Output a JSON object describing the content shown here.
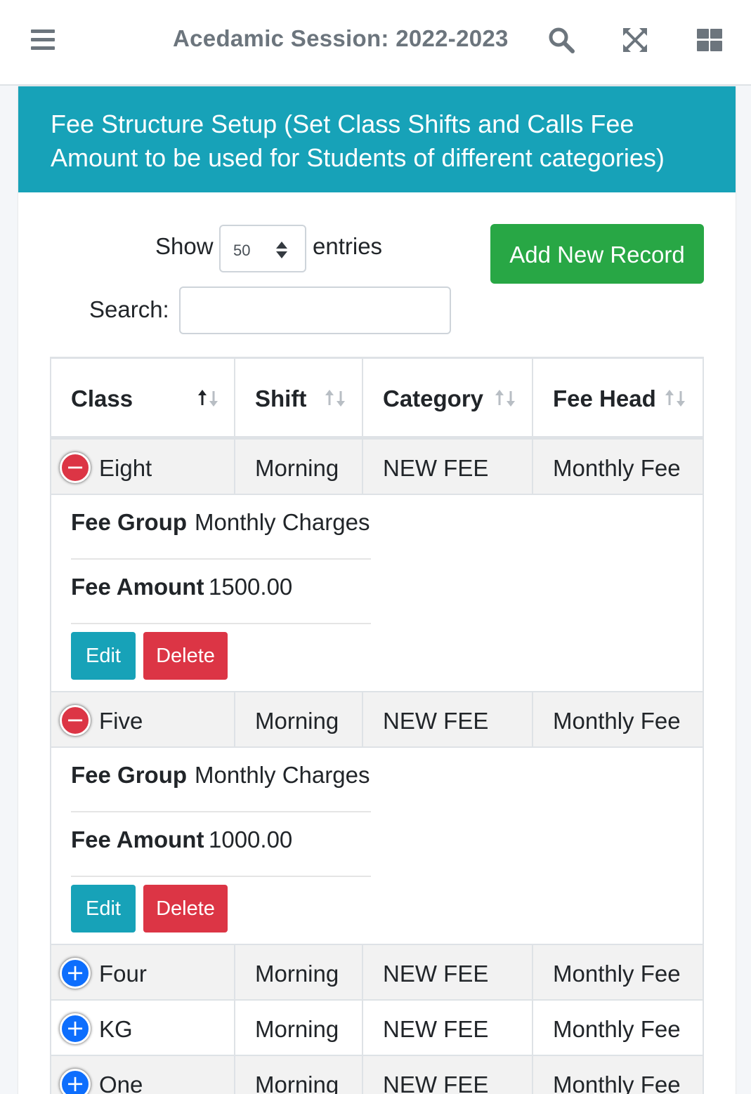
{
  "topbar": {
    "title": "Acedamic Session: 2022-2023",
    "icons": [
      "menu-icon",
      "search-icon",
      "fullscreen-icon",
      "apps-grid-icon"
    ]
  },
  "card": {
    "title": "Fee Structure Setup (Set Class Shifts and Calls Fee Amount to be used for Students of different categories)",
    "header_color": "#17a2b8"
  },
  "controls": {
    "show_label": "Show",
    "page_size": "50",
    "entries_label": "entries",
    "search_label": "Search:",
    "search_value": "",
    "add_button": "Add New Record",
    "add_button_color": "#28a745"
  },
  "table": {
    "columns": [
      "Class",
      "Shift",
      "Category",
      "Fee Head"
    ],
    "rows": [
      {
        "class": "Eight",
        "shift": "Morning",
        "category": "NEW FEE",
        "fee_head": "Monthly Fee",
        "expanded": true
      },
      {
        "class": "Five",
        "shift": "Morning",
        "category": "NEW FEE",
        "fee_head": "Monthly Fee",
        "expanded": true
      },
      {
        "class": "Four",
        "shift": "Morning",
        "category": "NEW FEE",
        "fee_head": "Monthly Fee",
        "expanded": false
      },
      {
        "class": "KG",
        "shift": "Morning",
        "category": "NEW FEE",
        "fee_head": "Monthly Fee",
        "expanded": false
      },
      {
        "class": "One",
        "shift": "Morning",
        "category": "NEW FEE",
        "fee_head": "Monthly Fee",
        "expanded": false
      }
    ],
    "details": [
      {
        "group_label": "Fee Group",
        "group_value": "Monthly Charges",
        "amount_label": "Fee Amount",
        "amount_value": "1500.00",
        "edit": "Edit",
        "delete": "Delete"
      },
      {
        "group_label": "Fee Group",
        "group_value": "Monthly Charges",
        "amount_label": "Fee Amount",
        "amount_value": "1000.00",
        "edit": "Edit",
        "delete": "Delete"
      }
    ],
    "toggle_minus": "−",
    "toggle_plus": "+"
  }
}
